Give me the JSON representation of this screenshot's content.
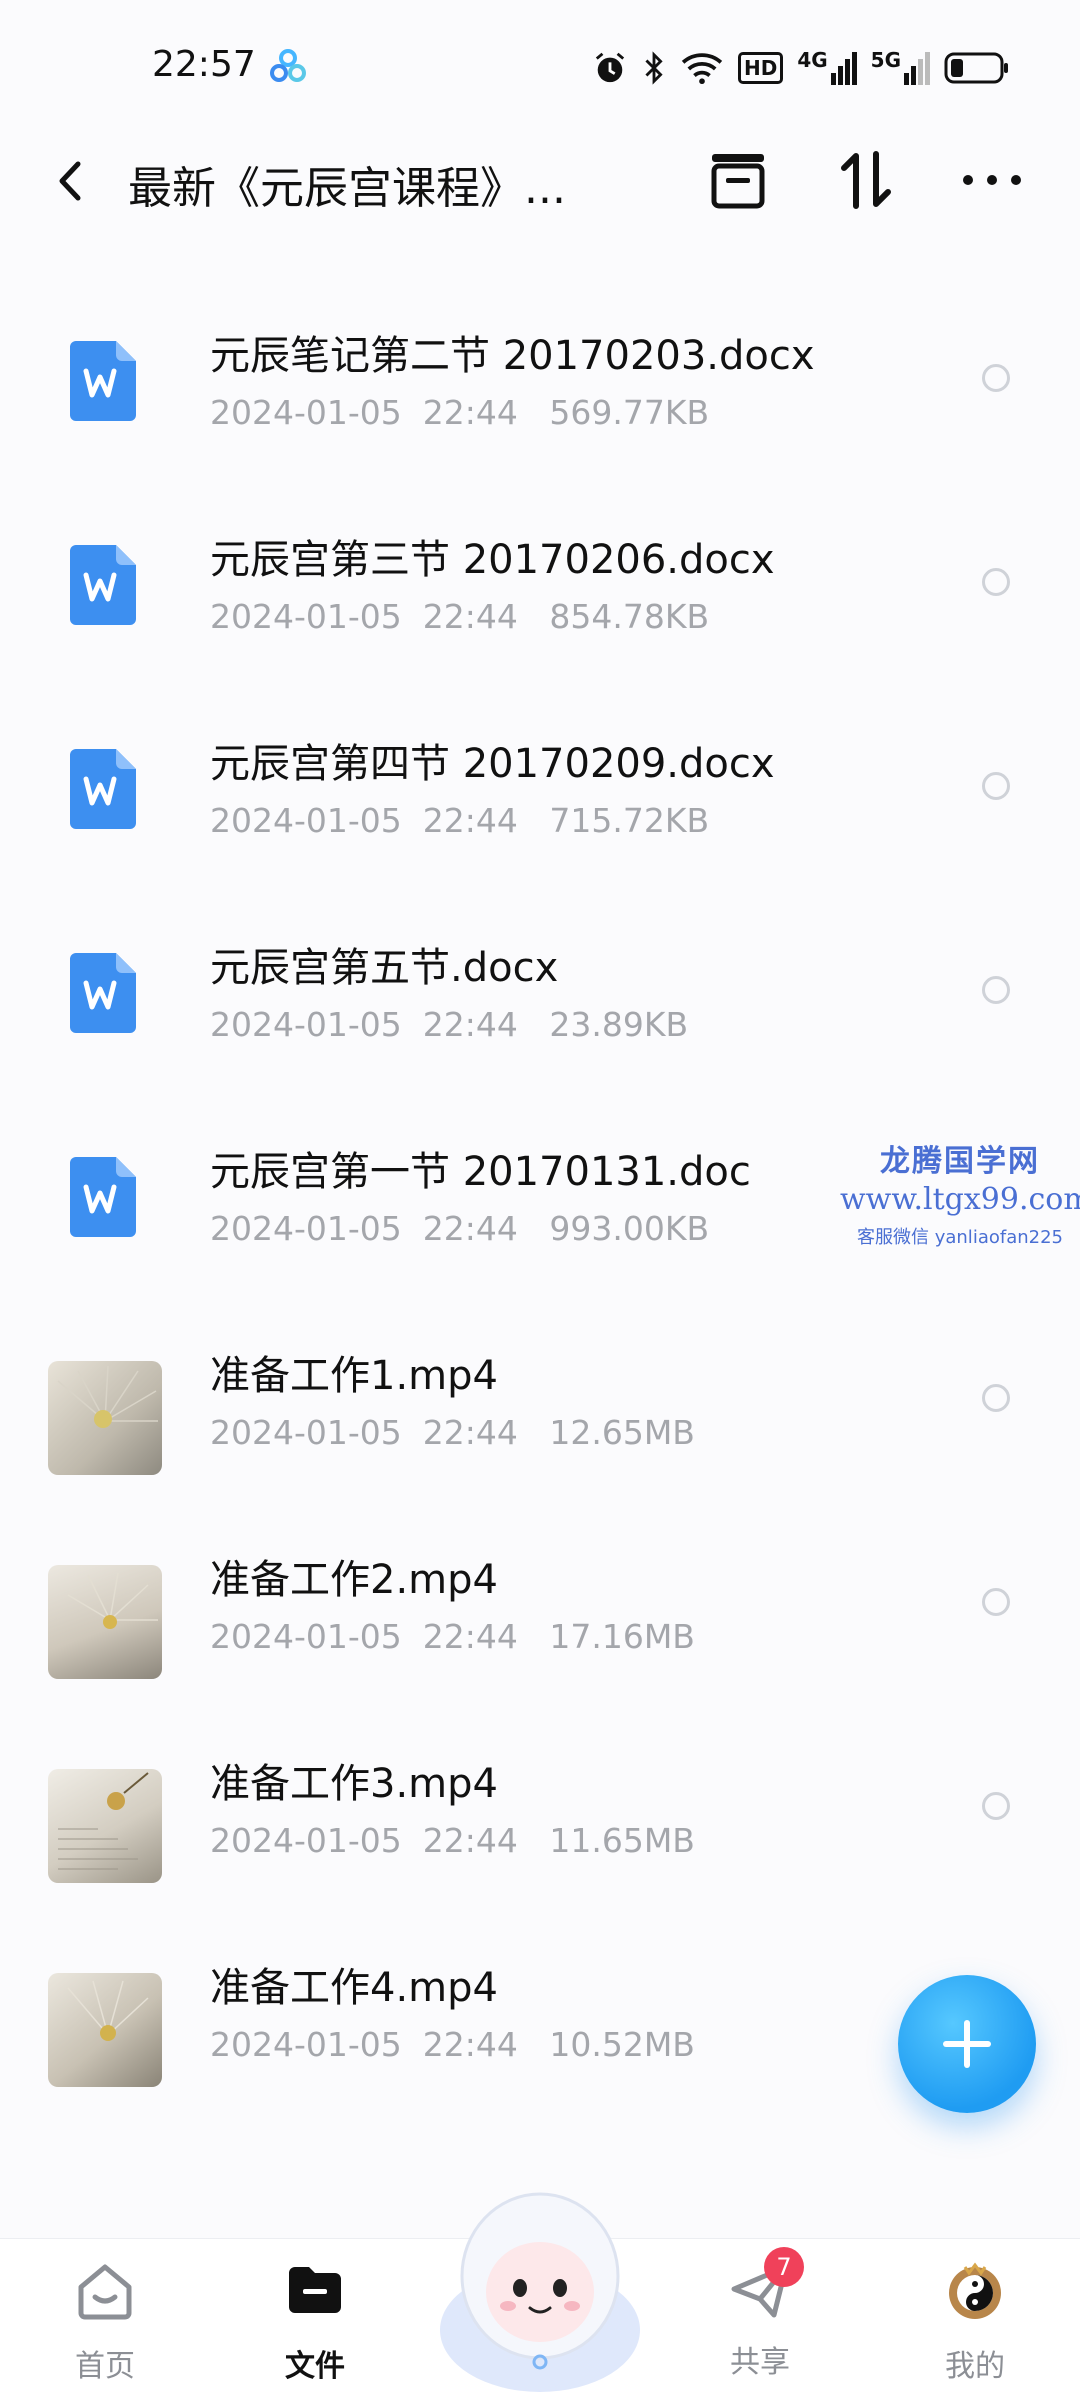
{
  "status_bar": {
    "time": "22:57",
    "network_1": "4G",
    "network_2": "5G",
    "hd": "HD"
  },
  "app_bar": {
    "title": "最新《元辰宫课程》..."
  },
  "files": [
    {
      "name": "元辰笔记第二节 20170203.docx",
      "date": "2024-01-05",
      "time": "22:44",
      "size": "569.77KB",
      "kind": "word"
    },
    {
      "name": "元辰宫第三节 20170206.docx",
      "date": "2024-01-05",
      "time": "22:44",
      "size": "854.78KB",
      "kind": "word"
    },
    {
      "name": "元辰宫第四节 20170209.docx",
      "date": "2024-01-05",
      "time": "22:44",
      "size": "715.72KB",
      "kind": "word"
    },
    {
      "name": "元辰宫第五节.docx",
      "date": "2024-01-05",
      "time": "22:44",
      "size": "23.89KB",
      "kind": "word"
    },
    {
      "name": "元辰宫第一节 20170131.doc",
      "date": "2024-01-05",
      "time": "22:44",
      "size": "993.00KB",
      "kind": "word"
    },
    {
      "name": "准备工作1.mp4",
      "date": "2024-01-05",
      "time": "22:44",
      "size": "12.65MB",
      "kind": "video"
    },
    {
      "name": "准备工作2.mp4",
      "date": "2024-01-05",
      "time": "22:44",
      "size": "17.16MB",
      "kind": "video"
    },
    {
      "name": "准备工作3.mp4",
      "date": "2024-01-05",
      "time": "22:44",
      "size": "11.65MB",
      "kind": "video"
    },
    {
      "name": "准备工作4.mp4",
      "date": "2024-01-05",
      "time": "22:44",
      "size": "10.52MB",
      "kind": "video"
    }
  ],
  "watermark": {
    "line1": "龙腾国学网",
    "line2": "www.ltgx99.com",
    "line3": "客服微信 yanliaofan225"
  },
  "nav": {
    "home": "首页",
    "files": "文件",
    "share": "共享",
    "share_badge": "7",
    "mine": "我的"
  },
  "colors": {
    "accent": "#1f9cf2",
    "word_icon": "#3d8ff0",
    "badge": "#f0415a"
  }
}
